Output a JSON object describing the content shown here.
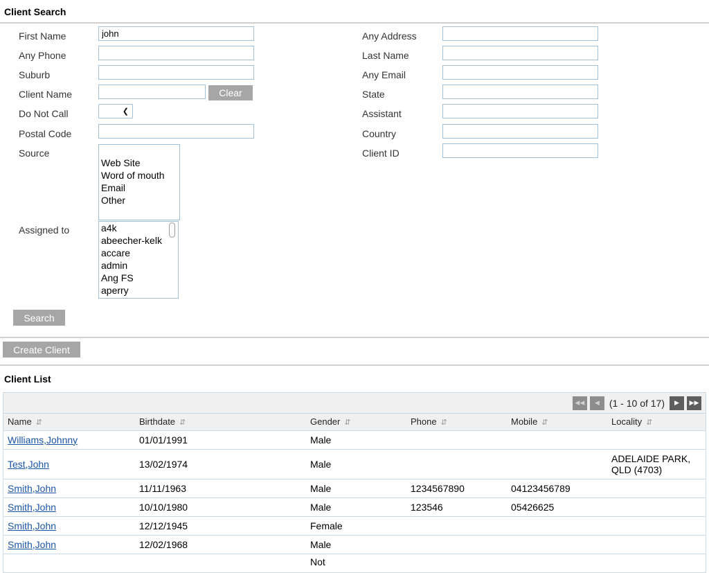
{
  "search_section": {
    "title": "Client Search",
    "fields": {
      "first_name": {
        "label": "First Name",
        "value": "john"
      },
      "any_phone": {
        "label": "Any Phone",
        "value": ""
      },
      "suburb": {
        "label": "Suburb",
        "value": ""
      },
      "client_name": {
        "label": "Client Name",
        "value": ""
      },
      "do_not_call": {
        "label": "Do Not Call",
        "value": ""
      },
      "postal_code": {
        "label": "Postal Code",
        "value": ""
      },
      "source": {
        "label": "Source",
        "options": [
          "Web Site",
          "Word of mouth",
          "Email",
          "Other"
        ]
      },
      "assigned_to": {
        "label": "Assigned to",
        "options": [
          "a4k",
          "abeecher-kelk",
          "accare",
          "admin",
          "Ang FS",
          "aperry"
        ]
      },
      "any_address": {
        "label": "Any Address",
        "value": ""
      },
      "last_name": {
        "label": "Last Name",
        "value": ""
      },
      "any_email": {
        "label": "Any Email",
        "value": ""
      },
      "state": {
        "label": "State",
        "value": ""
      },
      "assistant": {
        "label": "Assistant",
        "value": ""
      },
      "country": {
        "label": "Country",
        "value": ""
      },
      "client_id": {
        "label": "Client ID",
        "value": ""
      }
    },
    "clear_label": "Clear",
    "search_label": "Search"
  },
  "create_client_label": "Create Client",
  "client_list": {
    "title": "Client List",
    "pager_text": "(1 - 10 of 17)",
    "columns": [
      "Name",
      "Birthdate",
      "Gender",
      "Phone",
      "Mobile",
      "Locality"
    ],
    "rows": [
      {
        "name": "Williams,Johnny",
        "birthdate": "01/01/1991",
        "gender": "Male",
        "phone": "",
        "mobile": "",
        "locality": ""
      },
      {
        "name": "Test,John",
        "birthdate": "13/02/1974",
        "gender": "Male",
        "phone": "",
        "mobile": "",
        "locality": "ADELAIDE PARK, QLD (4703)"
      },
      {
        "name": "Smith,John",
        "birthdate": "11/11/1963",
        "gender": "Male",
        "phone": "1234567890",
        "mobile": "04123456789",
        "locality": ""
      },
      {
        "name": "Smith,John",
        "birthdate": "10/10/1980",
        "gender": "Male",
        "phone": "123546",
        "mobile": "05426625",
        "locality": ""
      },
      {
        "name": "Smith,John",
        "birthdate": "12/12/1945",
        "gender": "Female",
        "phone": "",
        "mobile": "",
        "locality": ""
      },
      {
        "name": "Smith,John",
        "birthdate": "12/02/1968",
        "gender": "Male",
        "phone": "",
        "mobile": "",
        "locality": ""
      },
      {
        "name": "",
        "birthdate": "",
        "gender": "Not",
        "phone": "",
        "mobile": "",
        "locality": ""
      }
    ]
  }
}
